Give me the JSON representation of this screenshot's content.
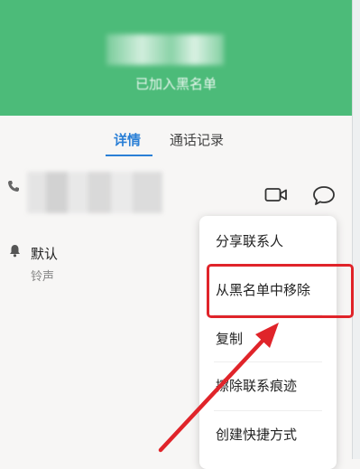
{
  "header": {
    "blocked_label": "已加入黑名单"
  },
  "tabs": [
    {
      "label": "详情",
      "active": true
    },
    {
      "label": "通话记录",
      "active": false
    }
  ],
  "contact": {
    "phone_icon": "phone-icon",
    "video_icon": "video-camera-icon",
    "chat_icon": "chat-bubble-icon"
  },
  "ringtone": {
    "value": "默认",
    "label": "铃声",
    "icon": "bell-icon"
  },
  "menu": {
    "items": [
      {
        "label": "分享联系人"
      },
      {
        "label": "从黑名单中移除",
        "highlighted": true
      },
      {
        "label": "复制"
      },
      {
        "label": "擦除联系痕迹"
      },
      {
        "label": "创建快捷方式"
      }
    ]
  },
  "colors": {
    "header": "#4cbb79",
    "accent": "#2a7fd6",
    "annotation": "#e0242a"
  }
}
